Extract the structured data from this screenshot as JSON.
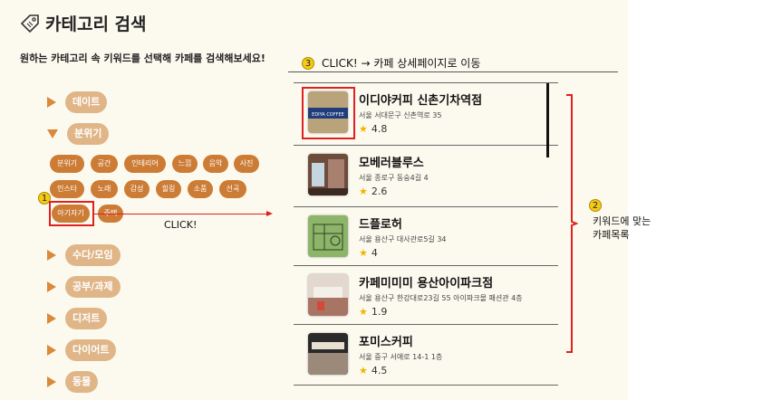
{
  "header": {
    "title": "카테고리 검색",
    "subtitle": "원하는 카테고리 속 키워드를 선택해 카페를 검색해보세요!"
  },
  "annotations": {
    "step3_number": "3",
    "step3_text": "CLICK! → 카페 상세페이지로 이동",
    "step1_number": "1",
    "click_label": "CLICK!",
    "step2_number": "2",
    "step2_line1": "키워드에 맞는",
    "step2_line2": "카페목록"
  },
  "categories": [
    "데이트",
    "분위기",
    "수다/모임",
    "공부/과제",
    "디저트",
    "다이어트",
    "동물"
  ],
  "keywords": [
    "분위기",
    "공간",
    "인테리어",
    "느낌",
    "음악",
    "사진",
    "인스타",
    "노래",
    "감성",
    "힐링",
    "소품",
    "선곡",
    "아기자기",
    "주택"
  ],
  "cafes": [
    {
      "name": "이디야커피 신촌기차역점",
      "address": "서울 서대문구 신촌역로 35",
      "rating": "4.8",
      "logo_text": "EDIYA COFFEE"
    },
    {
      "name": "모베러블루스",
      "address": "서울 종로구 동숭4길 4",
      "rating": "2.6"
    },
    {
      "name": "드플로허",
      "address": "서울 용산구 대사관로5길 34",
      "rating": "4"
    },
    {
      "name": "카페미미미 용산아이파크점",
      "address": "서울 용산구 한강대로23길 55 아이파크몰 패션관 4층",
      "rating": "1.9"
    },
    {
      "name": "포미스커피",
      "address": "서울 중구 서애로 14-1 1층",
      "rating": "4.5"
    }
  ],
  "colors": {
    "accent": "#cc7c35",
    "category_pill": "#e0b688",
    "highlight": "#e02020",
    "panel_bg": "#fcfaef"
  }
}
